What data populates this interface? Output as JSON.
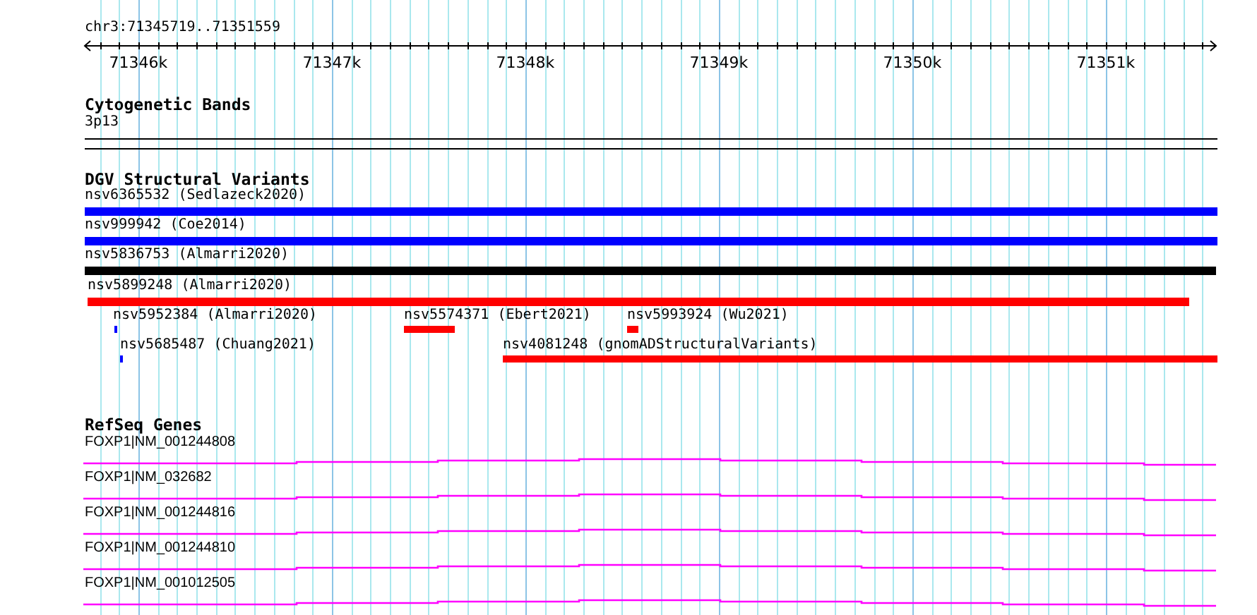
{
  "ruler": {
    "location": "chr3:71345719..71351559",
    "tick_labels": [
      "71346k",
      "71347k",
      "71348k",
      "71349k",
      "71350k",
      "71351k"
    ]
  },
  "tracks": [
    {
      "kind": "bands",
      "title": "Cytogenetic Bands",
      "features": [
        {
          "label": "3p13"
        }
      ]
    },
    {
      "kind": "variants",
      "title": "DGV Structural Variants",
      "features": [
        {
          "label": "nsv6365532 (Sedlazeck2020)",
          "color": "#0000ff"
        },
        {
          "label": "nsv999942 (Coe2014)",
          "color": "#0000ff"
        },
        {
          "label": "nsv5836753 (Almarri2020)",
          "color": "#000000"
        },
        {
          "label": "nsv5899248 (Almarri2020)",
          "color": "#ff0000"
        },
        {
          "label": "nsv5952384 (Almarri2020)",
          "color": "#0000ff"
        },
        {
          "label": "nsv5574371 (Ebert2021)",
          "color": "#ff0000"
        },
        {
          "label": "nsv5993924 (Wu2021)",
          "color": "#ff0000"
        },
        {
          "label": "nsv5685487 (Chuang2021)",
          "color": "#0000ff"
        },
        {
          "label": "nsv4081248 (gnomADStructuralVariants)",
          "color": "#ff0000"
        }
      ]
    },
    {
      "kind": "genes",
      "title": "RefSeq Genes",
      "features": [
        {
          "label": "FOXP1|NM_001244808"
        },
        {
          "label": "FOXP1|NM_032682"
        },
        {
          "label": "FOXP1|NM_001244816"
        },
        {
          "label": "FOXP1|NM_001244810"
        },
        {
          "label": "FOXP1|NM_001012505"
        }
      ]
    }
  ]
}
